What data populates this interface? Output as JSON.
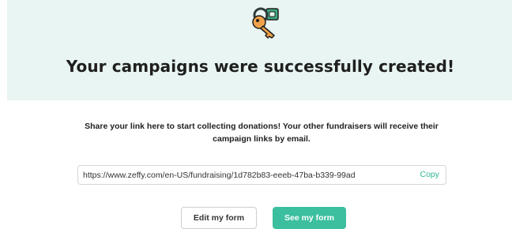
{
  "hero": {
    "icon": "key-icon",
    "title": "Your campaigns were successfully created!"
  },
  "description": "Share your link here to start collecting donations! Your other fundraisers will receive their campaign links by email.",
  "link": {
    "url": "https://www.zeffy.com/en-US/fundraising/1d782b83-eeeb-47ba-b339-99ad",
    "copy_label": "Copy"
  },
  "actions": {
    "edit_label": "Edit my form",
    "see_label": "See my form"
  },
  "colors": {
    "accent": "#3cbf9f",
    "hero_background": "#e8f5f2"
  }
}
